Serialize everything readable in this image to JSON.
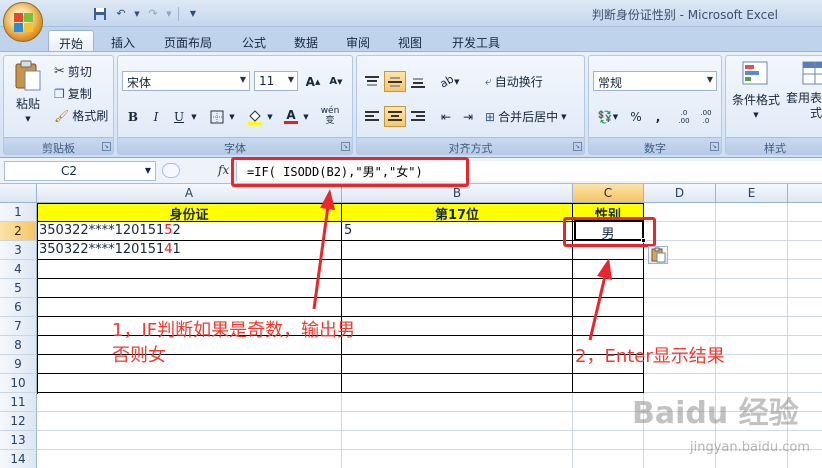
{
  "window": {
    "title": "判断身份证性别 - Microsoft Excel"
  },
  "tabs": [
    "开始",
    "插入",
    "页面布局",
    "公式",
    "数据",
    "审阅",
    "视图",
    "开发工具"
  ],
  "clipboard": {
    "paste": "粘贴",
    "cut": "剪切",
    "copy": "复制",
    "format_painter": "格式刷",
    "label": "剪贴板"
  },
  "font": {
    "name": "宋体",
    "size": "11",
    "label": "字体",
    "bold": "B",
    "italic": "I",
    "underline": "U",
    "grow": "A",
    "shrink": "A",
    "phonetic": "wén 变"
  },
  "alignment": {
    "wrap": "自动换行",
    "merge": "合并后居中",
    "label": "对齐方式"
  },
  "number": {
    "format": "常规",
    "label": "数字",
    "percent": "%",
    "comma": ",",
    "inc_decimal": ".0 .00",
    "dec_decimal": ".00 .0"
  },
  "styles": {
    "conditional": "条件格式",
    "table": "套用表格格式",
    "label": "样式"
  },
  "formula_bar": {
    "name_box": "C2",
    "fx": "fx",
    "formula": "=IF( ISODD(B2),\"男\",\"女\")"
  },
  "columns": [
    "A",
    "B",
    "C",
    "D",
    "E"
  ],
  "rows": [
    "1",
    "2",
    "3",
    "4",
    "5",
    "6",
    "7",
    "8",
    "9",
    "10",
    "11",
    "12",
    "13",
    "14"
  ],
  "sheet": {
    "header": [
      "身份证",
      "第17位",
      "性别"
    ],
    "row2": {
      "id_prefix": "350322****120151",
      "id_digit17": "5",
      "id_check": "2",
      "b": "5",
      "c": "男"
    },
    "row3": {
      "id_prefix": "350322****120151",
      "id_digit17": "4",
      "id_check": "1"
    }
  },
  "annotations": {
    "note1_line1": "1，IF判断如果是奇数，输出男",
    "note1_line2": "否则女",
    "note2": "2，Enter显示结果"
  },
  "watermark": {
    "main": "Baidu 经验",
    "sub": "jingyan.baidu.com"
  },
  "colors": {
    "annotation_red": "#e8262c",
    "header_fill": "#ffff00",
    "ribbon_blue": "#dbe7f6"
  }
}
